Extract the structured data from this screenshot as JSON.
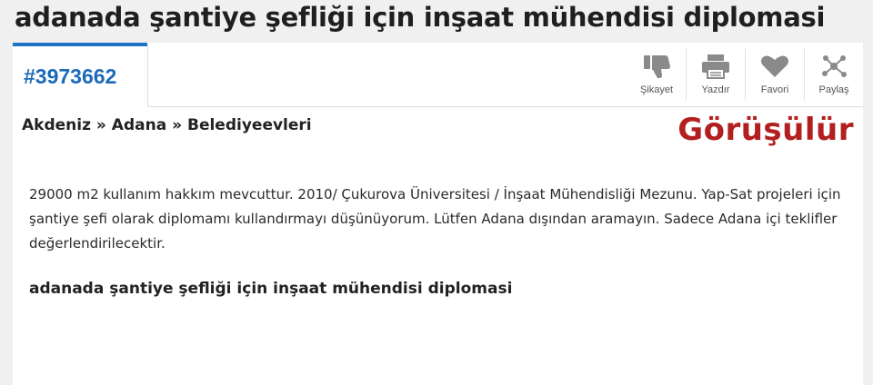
{
  "title": "adanada şantiye şefliği için inşaat mühendisi diplomasi",
  "listing": {
    "id": "#3973662",
    "breadcrumb": "Akdeniz » Adana » Belediyeevleri",
    "status": "Görüşülür",
    "description": "29000 m2 kullanım hakkım mevcuttur. 2010/ Çukurova Üniversitesi / İnşaat Mühendisliği Mezunu. Yap-Sat projeleri için şantiye şefi olarak diplomamı kullandırmayı düşünüyorum. Lütfen Adana dışından aramayın. Sadece Adana içi teklifler değerlendirilecektir.",
    "subheading": "adanada şantiye şefliği için inşaat mühendisi diplomasi"
  },
  "actions": [
    {
      "label": "Şikayet",
      "icon": "thumbs-down-icon"
    },
    {
      "label": "Yazdır",
      "icon": "printer-icon"
    },
    {
      "label": "Favori",
      "icon": "heart-icon"
    },
    {
      "label": "Paylaş",
      "icon": "share-icon"
    }
  ],
  "colors": {
    "accent": "#1f72c4",
    "status": "#b31e1e",
    "icon": "#8a8a8a"
  }
}
